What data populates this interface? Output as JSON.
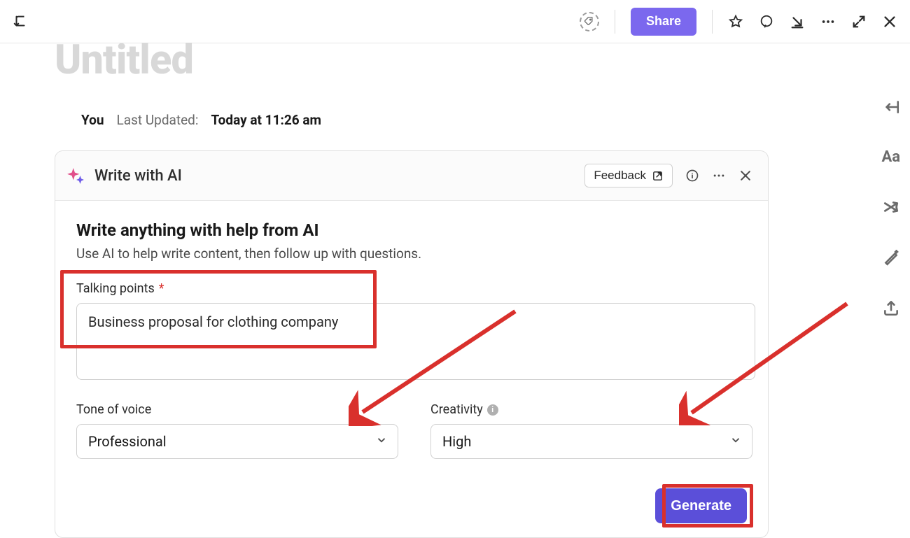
{
  "topbar": {
    "share_label": "Share"
  },
  "doc": {
    "title": "Untitled",
    "author": "You",
    "updated_label": "Last Updated:",
    "updated_time": "Today at 11:26 am"
  },
  "ai": {
    "title": "Write with AI",
    "feedback_label": "Feedback",
    "heading": "Write anything with help from AI",
    "sub": "Use AI to help write content, then follow up with questions.",
    "talking_label": "Talking points",
    "talking_value": "Business proposal for clothing company",
    "tone_label": "Tone of voice",
    "tone_value": "Professional",
    "creativity_label": "Creativity",
    "creativity_value": "High",
    "generate_label": "Generate"
  },
  "rsb": {
    "aa": "Aa"
  }
}
